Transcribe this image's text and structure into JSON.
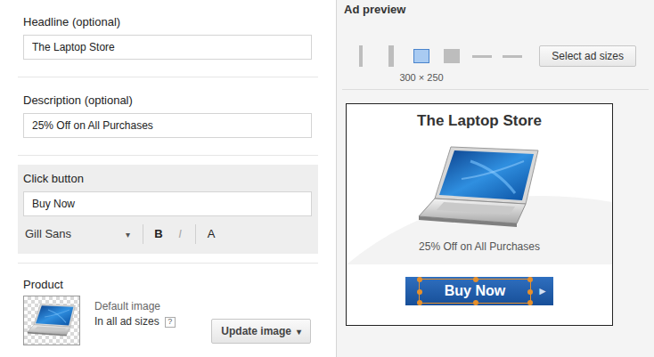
{
  "editor": {
    "headline": {
      "label": "Headline (optional)",
      "value": "The Laptop Store"
    },
    "description": {
      "label": "Description (optional)",
      "value": "25% Off on All Purchases"
    },
    "click_button": {
      "label": "Click button",
      "value": "Buy Now",
      "font": "Gill Sans",
      "font_arrow": "▾",
      "format_buttons": [
        {
          "label": "B",
          "kind": "bold",
          "disabled": false
        },
        {
          "label": "I",
          "kind": "italic",
          "disabled": true
        },
        {
          "label": "A",
          "kind": "color",
          "disabled": false
        }
      ]
    },
    "product": {
      "label": "Product",
      "image_caption": "Default image",
      "scope": "In all ad sizes",
      "help": "?",
      "button": "Update image",
      "button_arrow": "▾"
    }
  },
  "preview": {
    "title": "Ad preview",
    "sizes": [
      {
        "kind": "tall-narrow",
        "selected": false
      },
      {
        "kind": "tall",
        "selected": false
      },
      {
        "kind": "square",
        "selected": true,
        "label": "300 × 250"
      },
      {
        "kind": "square",
        "selected": false
      },
      {
        "kind": "wide",
        "selected": false
      },
      {
        "kind": "wide",
        "selected": false
      }
    ],
    "select_button": "Select ad sizes",
    "ad": {
      "headline": "The Laptop Store",
      "description": "25% Off on All Purchases",
      "button": "Buy Now",
      "arrow": "►",
      "button_selected": true
    }
  }
}
